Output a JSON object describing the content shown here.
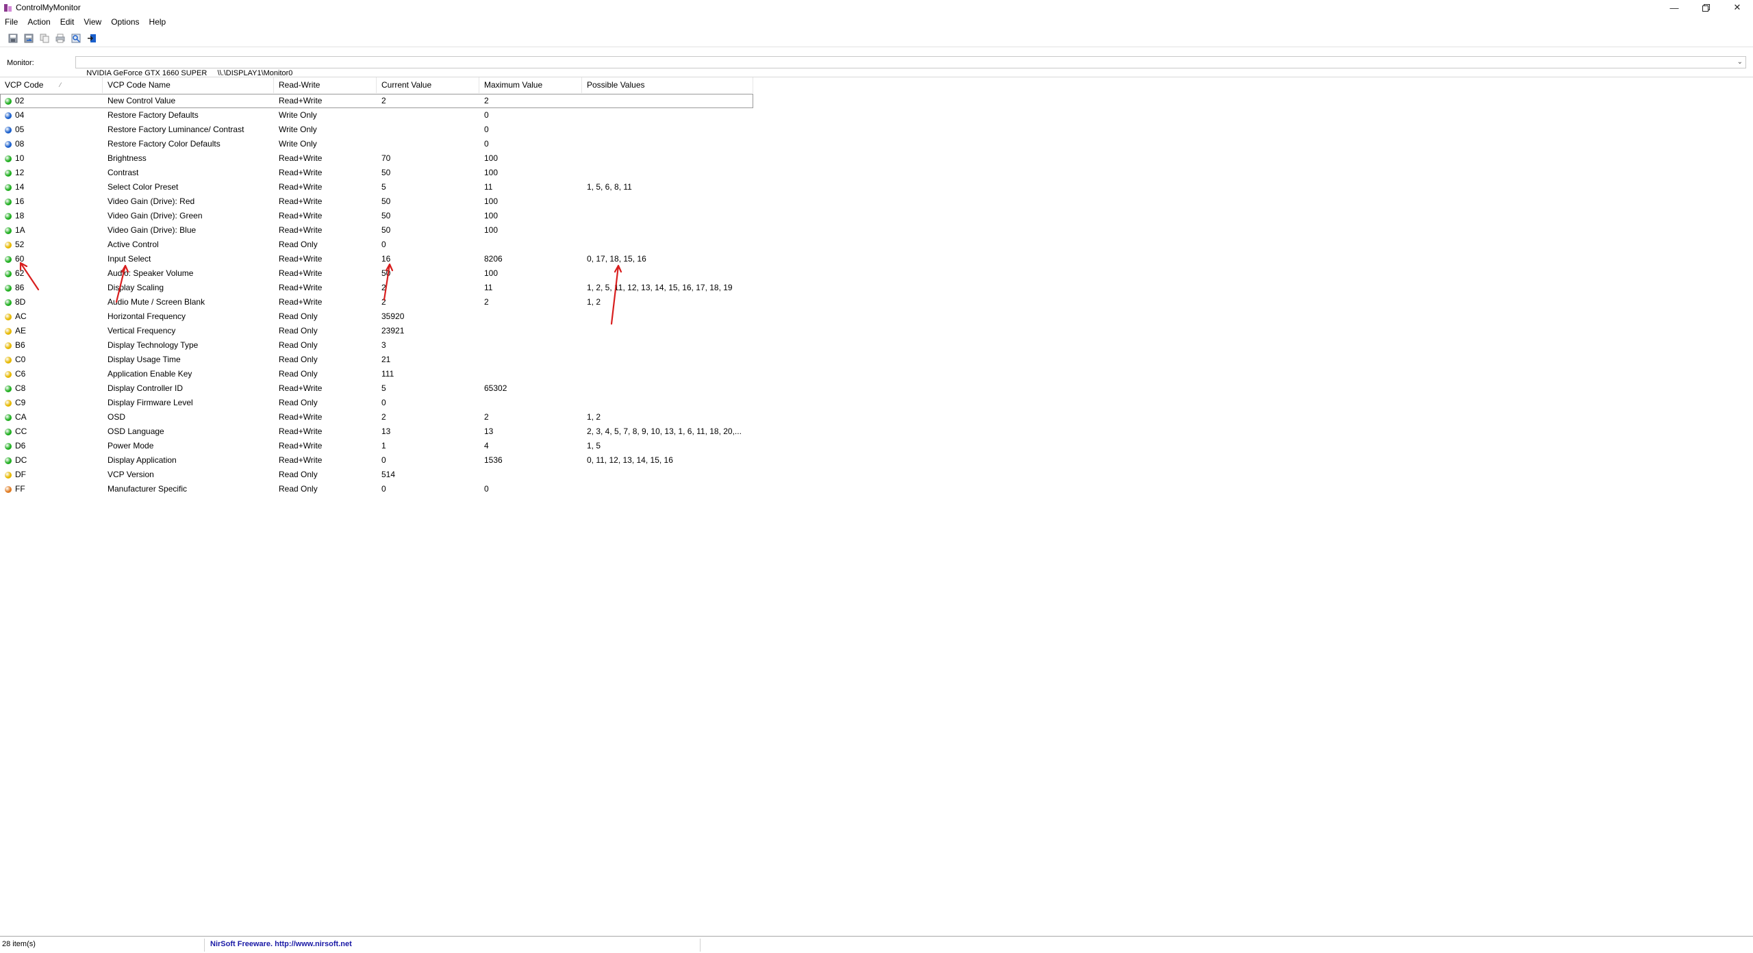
{
  "window": {
    "title": "ControlMyMonitor"
  },
  "menu": [
    "File",
    "Action",
    "Edit",
    "View",
    "Options",
    "Help"
  ],
  "toolbar": {
    "buttons": [
      "save-icon",
      "export-icon",
      "copy-icon",
      "print-icon",
      "properties-icon",
      "exit-icon"
    ]
  },
  "monitor": {
    "label": "Monitor:",
    "value": "NVIDIA GeForce GTX 1660 SUPER     \\\\.\\DISPLAY1\\Monitor0"
  },
  "columns": [
    "VCP Code",
    "VCP Code Name",
    "Read-Write",
    "Current Value",
    "Maximum Value",
    "Possible Values"
  ],
  "colors": {
    "green": "#1fae1f",
    "blue": "#1a5fcc",
    "yellow": "#e6b800",
    "orange": "#e07a1f",
    "annotation": "#d81e1e"
  },
  "rows": [
    {
      "dot": "green",
      "code": "02",
      "name": "New Control Value",
      "rw": "Read+Write",
      "current": "2",
      "max": "2",
      "possible": ""
    },
    {
      "dot": "blue",
      "code": "04",
      "name": "Restore Factory Defaults",
      "rw": "Write Only",
      "current": "",
      "max": "0",
      "possible": ""
    },
    {
      "dot": "blue",
      "code": "05",
      "name": "Restore Factory Luminance/ Contrast",
      "rw": "Write Only",
      "current": "",
      "max": "0",
      "possible": ""
    },
    {
      "dot": "blue",
      "code": "08",
      "name": "Restore Factory Color Defaults",
      "rw": "Write Only",
      "current": "",
      "max": "0",
      "possible": ""
    },
    {
      "dot": "green",
      "code": "10",
      "name": "Brightness",
      "rw": "Read+Write",
      "current": "70",
      "max": "100",
      "possible": ""
    },
    {
      "dot": "green",
      "code": "12",
      "name": "Contrast",
      "rw": "Read+Write",
      "current": "50",
      "max": "100",
      "possible": ""
    },
    {
      "dot": "green",
      "code": "14",
      "name": "Select Color Preset",
      "rw": "Read+Write",
      "current": "5",
      "max": "11",
      "possible": "1, 5, 6, 8, 11"
    },
    {
      "dot": "green",
      "code": "16",
      "name": "Video Gain (Drive): Red",
      "rw": "Read+Write",
      "current": "50",
      "max": "100",
      "possible": ""
    },
    {
      "dot": "green",
      "code": "18",
      "name": "Video Gain (Drive): Green",
      "rw": "Read+Write",
      "current": "50",
      "max": "100",
      "possible": ""
    },
    {
      "dot": "green",
      "code": "1A",
      "name": "Video Gain (Drive): Blue",
      "rw": "Read+Write",
      "current": "50",
      "max": "100",
      "possible": ""
    },
    {
      "dot": "yellow",
      "code": "52",
      "name": "Active Control",
      "rw": "Read Only",
      "current": "0",
      "max": "",
      "possible": ""
    },
    {
      "dot": "green",
      "code": "60",
      "name": "Input Select",
      "rw": "Read+Write",
      "current": "16",
      "max": "8206",
      "possible": "0, 17, 18, 15, 16"
    },
    {
      "dot": "green",
      "code": "62",
      "name": "Audio: Speaker Volume",
      "rw": "Read+Write",
      "current": "50",
      "max": "100",
      "possible": ""
    },
    {
      "dot": "green",
      "code": "86",
      "name": "Display Scaling",
      "rw": "Read+Write",
      "current": "2",
      "max": "11",
      "possible": "1, 2, 5, 11, 12, 13, 14, 15, 16, 17, 18, 19"
    },
    {
      "dot": "green",
      "code": "8D",
      "name": "Audio Mute / Screen Blank",
      "rw": "Read+Write",
      "current": "2",
      "max": "2",
      "possible": "1, 2"
    },
    {
      "dot": "yellow",
      "code": "AC",
      "name": "Horizontal Frequency",
      "rw": "Read Only",
      "current": "35920",
      "max": "",
      "possible": ""
    },
    {
      "dot": "yellow",
      "code": "AE",
      "name": "Vertical Frequency",
      "rw": "Read Only",
      "current": "23921",
      "max": "",
      "possible": ""
    },
    {
      "dot": "yellow",
      "code": "B6",
      "name": "Display Technology Type",
      "rw": "Read Only",
      "current": "3",
      "max": "",
      "possible": ""
    },
    {
      "dot": "yellow",
      "code": "C0",
      "name": "Display Usage Time",
      "rw": "Read Only",
      "current": "21",
      "max": "",
      "possible": ""
    },
    {
      "dot": "yellow",
      "code": "C6",
      "name": "Application Enable Key",
      "rw": "Read Only",
      "current": "111",
      "max": "",
      "possible": ""
    },
    {
      "dot": "green",
      "code": "C8",
      "name": "Display Controller ID",
      "rw": "Read+Write",
      "current": "5",
      "max": "65302",
      "possible": ""
    },
    {
      "dot": "yellow",
      "code": "C9",
      "name": "Display Firmware Level",
      "rw": "Read Only",
      "current": "0",
      "max": "",
      "possible": ""
    },
    {
      "dot": "green",
      "code": "CA",
      "name": "OSD",
      "rw": "Read+Write",
      "current": "2",
      "max": "2",
      "possible": "1, 2"
    },
    {
      "dot": "green",
      "code": "CC",
      "name": "OSD Language",
      "rw": "Read+Write",
      "current": "13",
      "max": "13",
      "possible": "2, 3, 4, 5, 7, 8, 9, 10, 13, 1, 6, 11, 18, 20,..."
    },
    {
      "dot": "green",
      "code": "D6",
      "name": "Power Mode",
      "rw": "Read+Write",
      "current": "1",
      "max": "4",
      "possible": "1, 5"
    },
    {
      "dot": "green",
      "code": "DC",
      "name": "Display Application",
      "rw": "Read+Write",
      "current": "0",
      "max": "1536",
      "possible": "0, 11, 12, 13, 14, 15, 16"
    },
    {
      "dot": "yellow",
      "code": "DF",
      "name": "VCP Version",
      "rw": "Read Only",
      "current": "514",
      "max": "",
      "possible": ""
    },
    {
      "dot": "orange",
      "code": "FF",
      "name": "Manufacturer Specific",
      "rw": "Read Only",
      "current": "0",
      "max": "0",
      "possible": ""
    }
  ],
  "status": {
    "count": "28 item(s)",
    "credit": "NirSoft Freeware.  http://www.nirsoft.net"
  }
}
